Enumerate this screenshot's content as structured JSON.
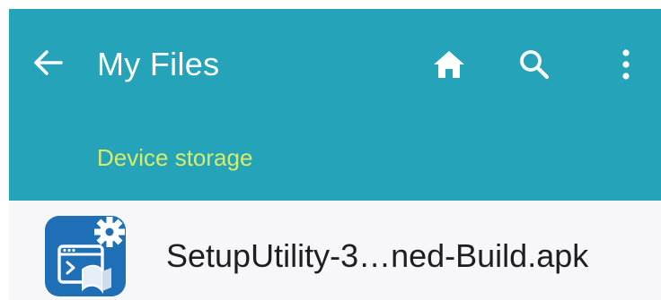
{
  "toolbar": {
    "back_icon": "arrow-left-icon",
    "title": "My Files",
    "home_icon": "home-icon",
    "search_icon": "search-icon",
    "more_icon": "more-vertical-icon"
  },
  "breadcrumb": {
    "label": "Device storage"
  },
  "files": [
    {
      "name": "SetupUtility-3…ned-Build.apk",
      "icon": "apk-installer-icon"
    }
  ],
  "colors": {
    "appbar": "#24a3b9",
    "breadcrumb_text": "#d6ec6a",
    "list_background": "#f7f7f9",
    "apk_icon_bg": "#1e6fb5"
  }
}
